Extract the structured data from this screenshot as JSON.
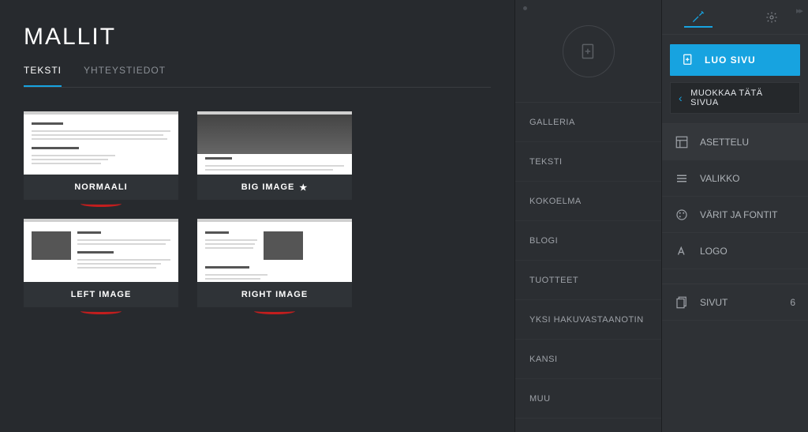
{
  "title": "MALLIT",
  "tabs": [
    {
      "label": "TEKSTI",
      "active": true
    },
    {
      "label": "YHTEYSTIEDOT",
      "active": false
    }
  ],
  "templates": [
    {
      "label": "NORMAALI",
      "starred": false,
      "underline": true,
      "kind": "normal"
    },
    {
      "label": "BIG IMAGE",
      "starred": true,
      "underline": false,
      "kind": "bigimg"
    },
    {
      "label": "LEFT IMAGE",
      "starred": false,
      "underline": true,
      "kind": "leftimg"
    },
    {
      "label": "RIGHT IMAGE",
      "starred": false,
      "underline": true,
      "kind": "rightimg"
    }
  ],
  "panel_items": [
    {
      "label": "GALLERIA"
    },
    {
      "label": "TEKSTI"
    },
    {
      "label": "KOKOELMA"
    },
    {
      "label": "BLOGI"
    },
    {
      "label": "TUOTTEET"
    },
    {
      "label": "YKSI HAKUVASTAANOTIN"
    },
    {
      "label": "KANSI"
    },
    {
      "label": "MUU"
    }
  ],
  "right": {
    "create_label": "LUO SIVU",
    "edit_label": "MUOKKAA TÄTÄ SIVUA",
    "sections1": [
      {
        "label": "ASETTELU",
        "icon": "layout"
      },
      {
        "label": "VALIKKO",
        "icon": "menu"
      },
      {
        "label": "VÄRIT JA FONTIT",
        "icon": "palette"
      },
      {
        "label": "LOGO",
        "icon": "logo"
      }
    ],
    "sections2": [
      {
        "label": "SIVUT",
        "icon": "pages",
        "count": "6"
      }
    ]
  }
}
